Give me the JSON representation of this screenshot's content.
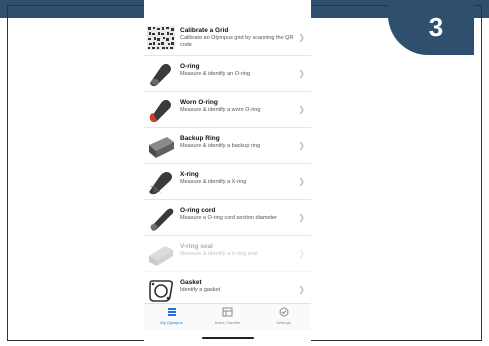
{
  "step_number": "3",
  "colors": {
    "header": "#2f4f6f",
    "accent": "#1e73e8",
    "ring": "#3a3a3a",
    "worn": "#d23b2a"
  },
  "list": {
    "items": [
      {
        "title": "Calibrate a Grid",
        "subtitle": "Calibrate an Olympus grid by scanning the QR code",
        "icon": "qr-grid-icon"
      },
      {
        "title": "O-ring",
        "subtitle": "Measure & identify an O-ring",
        "icon": "o-ring-icon"
      },
      {
        "title": "Worn O-ring",
        "subtitle": "Measure & identify a worn O-ring",
        "icon": "worn-o-ring-icon"
      },
      {
        "title": "Backup Ring",
        "subtitle": "Measure & identify a backup ring",
        "icon": "backup-ring-icon"
      },
      {
        "title": "X-ring",
        "subtitle": "Measure & identify a X-ring",
        "icon": "x-ring-icon"
      },
      {
        "title": "O-ring cord",
        "subtitle": "Measure a O-ring cord section diameter",
        "icon": "o-ring-cord-icon"
      },
      {
        "title": "V-ring seal",
        "subtitle": "Measure & identify a V-ring seal",
        "icon": "v-ring-seal-icon"
      },
      {
        "title": "Gasket",
        "subtitle": "Identify a gasket",
        "icon": "gasket-icon"
      }
    ]
  },
  "tabbar": {
    "tabs": [
      {
        "label": "My Olympus",
        "icon": "list-icon",
        "active": true
      },
      {
        "label": "Sales Transfer",
        "icon": "transfer-icon",
        "active": false
      },
      {
        "label": "Settings",
        "icon": "settings-icon",
        "active": false
      }
    ]
  }
}
